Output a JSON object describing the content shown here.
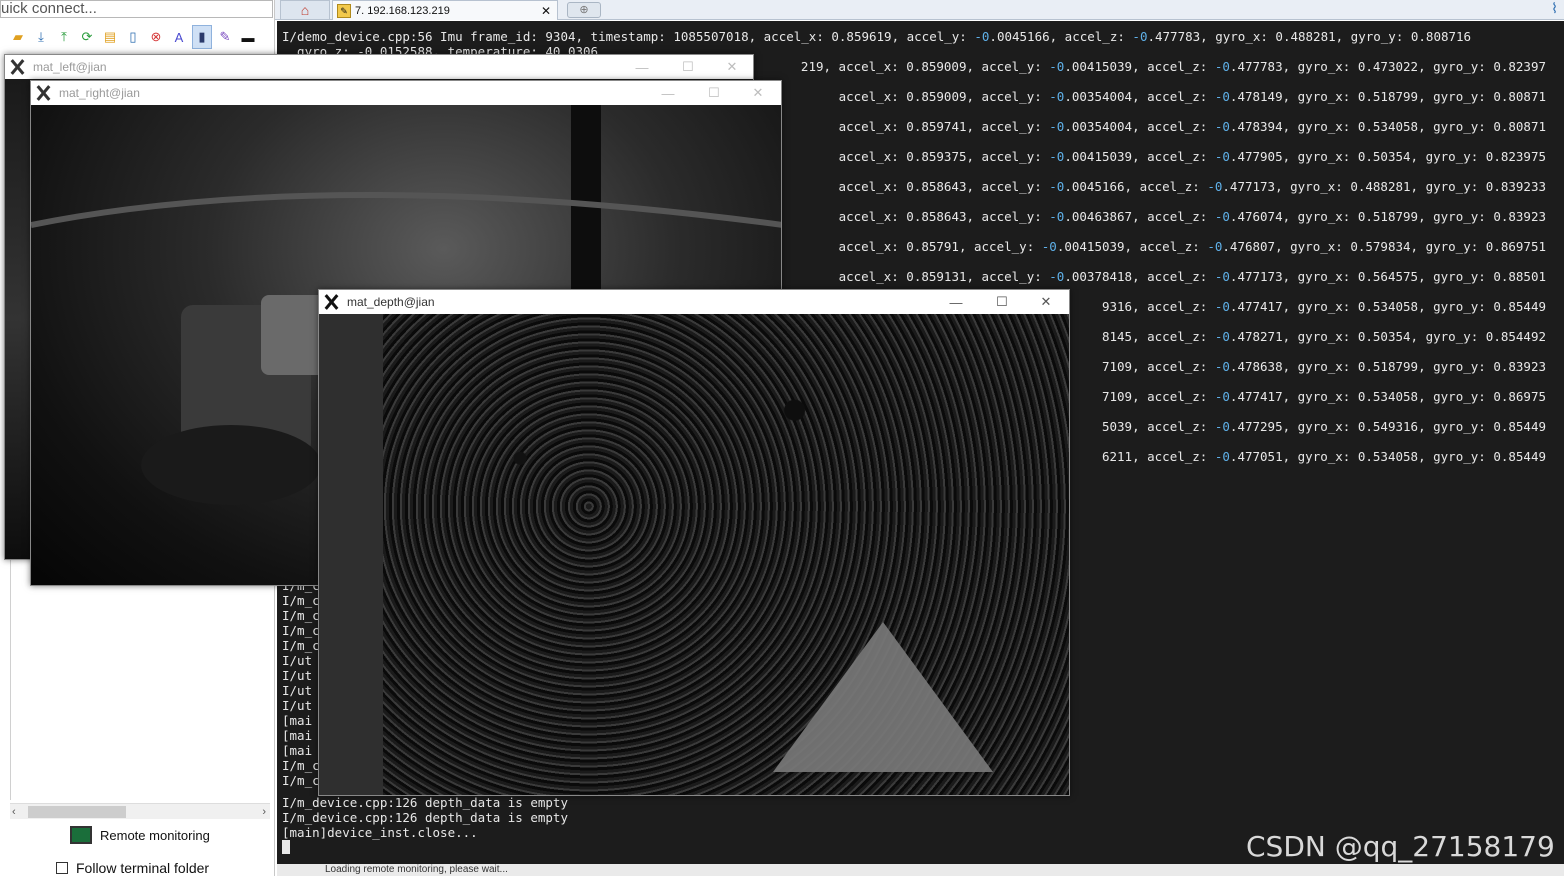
{
  "left_pane": {
    "quick_connect": "uick connect...",
    "toolbar_icons": [
      "folder-icon",
      "download-icon",
      "upload-icon",
      "refresh-icon",
      "new-folder-icon",
      "new-file-icon",
      "delete-icon",
      "rename-icon",
      "properties-icon",
      "edit-icon",
      "terminal-icon"
    ],
    "remote_monitoring": "Remote monitoring",
    "follow_folder": "Follow terminal folder"
  },
  "tabs": {
    "session_tab": "7. 192.168.123.219"
  },
  "terminal": {
    "lines": [
      {
        "t": "I/demo_device.cpp:56 Imu frame_id: 9304, timestamp: 1085507018, accel_x: 0.859619, accel_y: ",
        "n1": "-0",
        "m1": ".0045166, accel_z: ",
        "n2": "-0",
        "m2": ".477783, gyro_x: 0.488281, gyro_y: 0.808716"
      },
      {
        "t": "  gyro_z: -0.0152588, temperature: 40.0306",
        "n1": "",
        "m1": "",
        "n2": "",
        "m2": ""
      }
    ],
    "right_lines": [
      {
        "pre": "219, accel_x: 0.859009, accel_y: ",
        "a": "-0",
        "b": ".00415039, accel_z: ",
        "c": "-0",
        "d": ".477783, gyro_x: 0.473022, gyro_y: 0.82397"
      },
      {
        "pre": "accel_x: 0.859009, accel_y: ",
        "a": "-0",
        "b": ".00354004, accel_z: ",
        "c": "-0",
        "d": ".478149, gyro_x: 0.518799, gyro_y: 0.80871"
      },
      {
        "pre": "accel_x: 0.859741, accel_y: ",
        "a": "-0",
        "b": ".00354004, accel_z: ",
        "c": "-0",
        "d": ".478394, gyro_x: 0.534058, gyro_y: 0.80871"
      },
      {
        "pre": "accel_x: 0.859375, accel_y: ",
        "a": "-0",
        "b": ".00415039, accel_z: ",
        "c": "-0",
        "d": ".477905, gyro_x: 0.50354, gyro_y: 0.823975"
      },
      {
        "pre": "accel_x: 0.858643, accel_y: ",
        "a": "-0",
        "b": ".0045166, accel_z: ",
        "c": "-0",
        "d": ".477173, gyro_x: 0.488281, gyro_y: 0.839233"
      },
      {
        "pre": "accel_x: 0.858643, accel_y: ",
        "a": "-0",
        "b": ".00463867, accel_z: ",
        "c": "-0",
        "d": ".476074, gyro_x: 0.518799, gyro_y: 0.83923"
      },
      {
        "pre": "accel_x: 0.85791, accel_y: ",
        "a": "-0",
        "b": ".00415039, accel_z: ",
        "c": "-0",
        "d": ".476807, gyro_x: 0.579834, gyro_y: 0.869751"
      },
      {
        "pre": "accel_x: 0.859131, accel_y: ",
        "a": "-0",
        "b": ".00378418, accel_z: ",
        "c": "-0",
        "d": ".477173, gyro_x: 0.564575, gyro_y: 0.88501"
      },
      {
        "pre": "",
        "a": "",
        "b": "9316, accel_z: ",
        "c": "-0",
        "d": ".477417, gyro_x: 0.534058, gyro_y: 0.85449"
      },
      {
        "pre": "",
        "a": "",
        "b": "8145, accel_z: ",
        "c": "-0",
        "d": ".478271, gyro_x: 0.50354, gyro_y: 0.854492"
      },
      {
        "pre": "",
        "a": "",
        "b": "7109, accel_z: ",
        "c": "-0",
        "d": ".478638, gyro_x: 0.518799, gyro_y: 0.83923"
      },
      {
        "pre": "",
        "a": "",
        "b": "7109, accel_z: ",
        "c": "-0",
        "d": ".477417, gyro_x: 0.534058, gyro_y: 0.86975"
      },
      {
        "pre": "",
        "a": "",
        "b": "5039, accel_z: ",
        "c": "-0",
        "d": ".477295, gyro_x: 0.549316, gyro_y: 0.85449"
      },
      {
        "pre": "",
        "a": "",
        "b": "6211, accel_z: ",
        "c": "-0",
        "d": ".477051, gyro_x: 0.534058, gyro_y: 0.85449"
      }
    ],
    "bottom_lines": [
      "I/m_c",
      "I/m_c",
      "I/m_c",
      "I/m_c",
      "I/m_c",
      "I/ut",
      "I/ut",
      "I/ut",
      "I/ut",
      "[mai",
      "[mai",
      "[mai",
      "I/m_c",
      "I/m_c"
    ],
    "final_lines": [
      "I/m_device.cpp:126 depth_data is empty",
      "I/m_device.cpp:126 depth_data is empty",
      "[main]device_inst.close..."
    ],
    "status": "Loading remote monitoring, please wait..."
  },
  "windows": {
    "left": {
      "title": "mat_left@jian"
    },
    "right": {
      "title": "mat_right@jian"
    },
    "depth": {
      "title": "mat_depth@jian"
    },
    "controls": {
      "minimize": "—",
      "maximize": "☐",
      "close": "✕"
    }
  },
  "watermark": "CSDN @qq_27158179",
  "colors": {
    "terminal_bg": "#1c1c1c",
    "terminal_fg": "#e8e8e8",
    "negative_accent": "#5fb0e8"
  }
}
